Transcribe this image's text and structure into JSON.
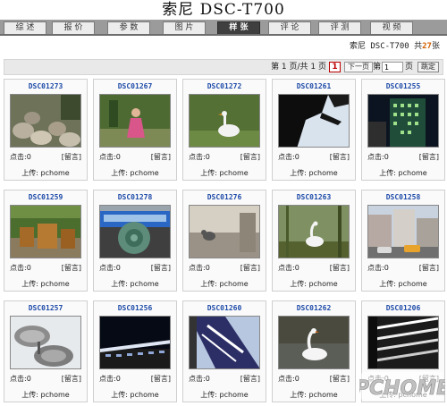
{
  "title": "索尼 DSC-T700",
  "tabs": [
    "综 述",
    "报 价",
    "参 数",
    "图 片",
    "样 张",
    "评 论",
    "评 测",
    "视 频"
  ],
  "active_tab": 4,
  "info": {
    "prefix": "索尼 DSC-T700 共",
    "count": "27",
    "suffix": "张"
  },
  "pager": {
    "status": "第 1 页/共 1 页",
    "current_page": "1",
    "next": "下一页",
    "goto_prefix": "第",
    "goto_value": "1",
    "goto_suffix": "页",
    "go": "跳定"
  },
  "card_labels": {
    "clicks": "点击:0",
    "message": "[留言]",
    "uploader": "上传: pchome"
  },
  "photos": [
    {
      "name": "DSC01273",
      "scene": "rocks"
    },
    {
      "name": "DSC01267",
      "scene": "girl"
    },
    {
      "name": "DSC01272",
      "scene": "goose"
    },
    {
      "name": "DSC01261",
      "scene": "tree-dark"
    },
    {
      "name": "DSC01255",
      "scene": "building-night"
    },
    {
      "name": "DSC01259",
      "scene": "chairs"
    },
    {
      "name": "DSC01278",
      "scene": "bus"
    },
    {
      "name": "DSC01276",
      "scene": "cat-wall"
    },
    {
      "name": "DSC01263",
      "scene": "swan-grass"
    },
    {
      "name": "DSC01258",
      "scene": "street"
    },
    {
      "name": "DSC01257",
      "scene": "dishes"
    },
    {
      "name": "DSC01256",
      "scene": "night-building"
    },
    {
      "name": "DSC01260",
      "scene": "sign-sky"
    },
    {
      "name": "DSC01262",
      "scene": "swan-water"
    },
    {
      "name": "DSC01206",
      "scene": "fluorescent"
    }
  ],
  "watermark": "PCHOME"
}
